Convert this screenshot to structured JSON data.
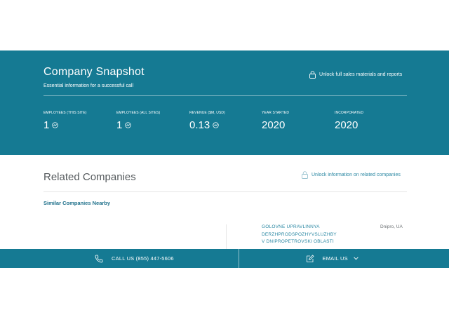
{
  "snapshot": {
    "title": "Company Snapshot",
    "subtitle": "Essential information for a successful call",
    "unlock_label": "Unlock full sales materials and reports",
    "stats": [
      {
        "label": "EMPLOYEES (THIS SITE)",
        "value": "1",
        "trend_icon": true
      },
      {
        "label": "EMPLOYEES (ALL SITES)",
        "value": "1",
        "trend_icon": true
      },
      {
        "label": "REVENUE ($M, USD)",
        "value": "0.13",
        "trend_icon": true
      },
      {
        "label": "YEAR STARTED",
        "value": "2020",
        "trend_icon": false
      },
      {
        "label": "INCORPORATED",
        "value": "2020",
        "trend_icon": false
      }
    ]
  },
  "related": {
    "title": "Related Companies",
    "unlock_label": "Unlock information on related companies",
    "similar_heading": "Similar Companies Nearby",
    "company": {
      "name_lines": [
        "GOLOVNE UPRAVLINNYA",
        "DERZHPRODSPOZHYVSLUZHBY",
        "V DNIPROPETROVSKI OBLASTI"
      ],
      "location": "Dnipro, UA"
    }
  },
  "footer": {
    "call_label": "CALL US (855) 447-5606",
    "email_label": "EMAIL US"
  },
  "colors": {
    "accent": "#157a93",
    "link": "#2b88a3"
  },
  "icons": [
    "lock-icon",
    "trend-icon",
    "phone-icon",
    "edit-icon",
    "chevron-down-icon"
  ]
}
